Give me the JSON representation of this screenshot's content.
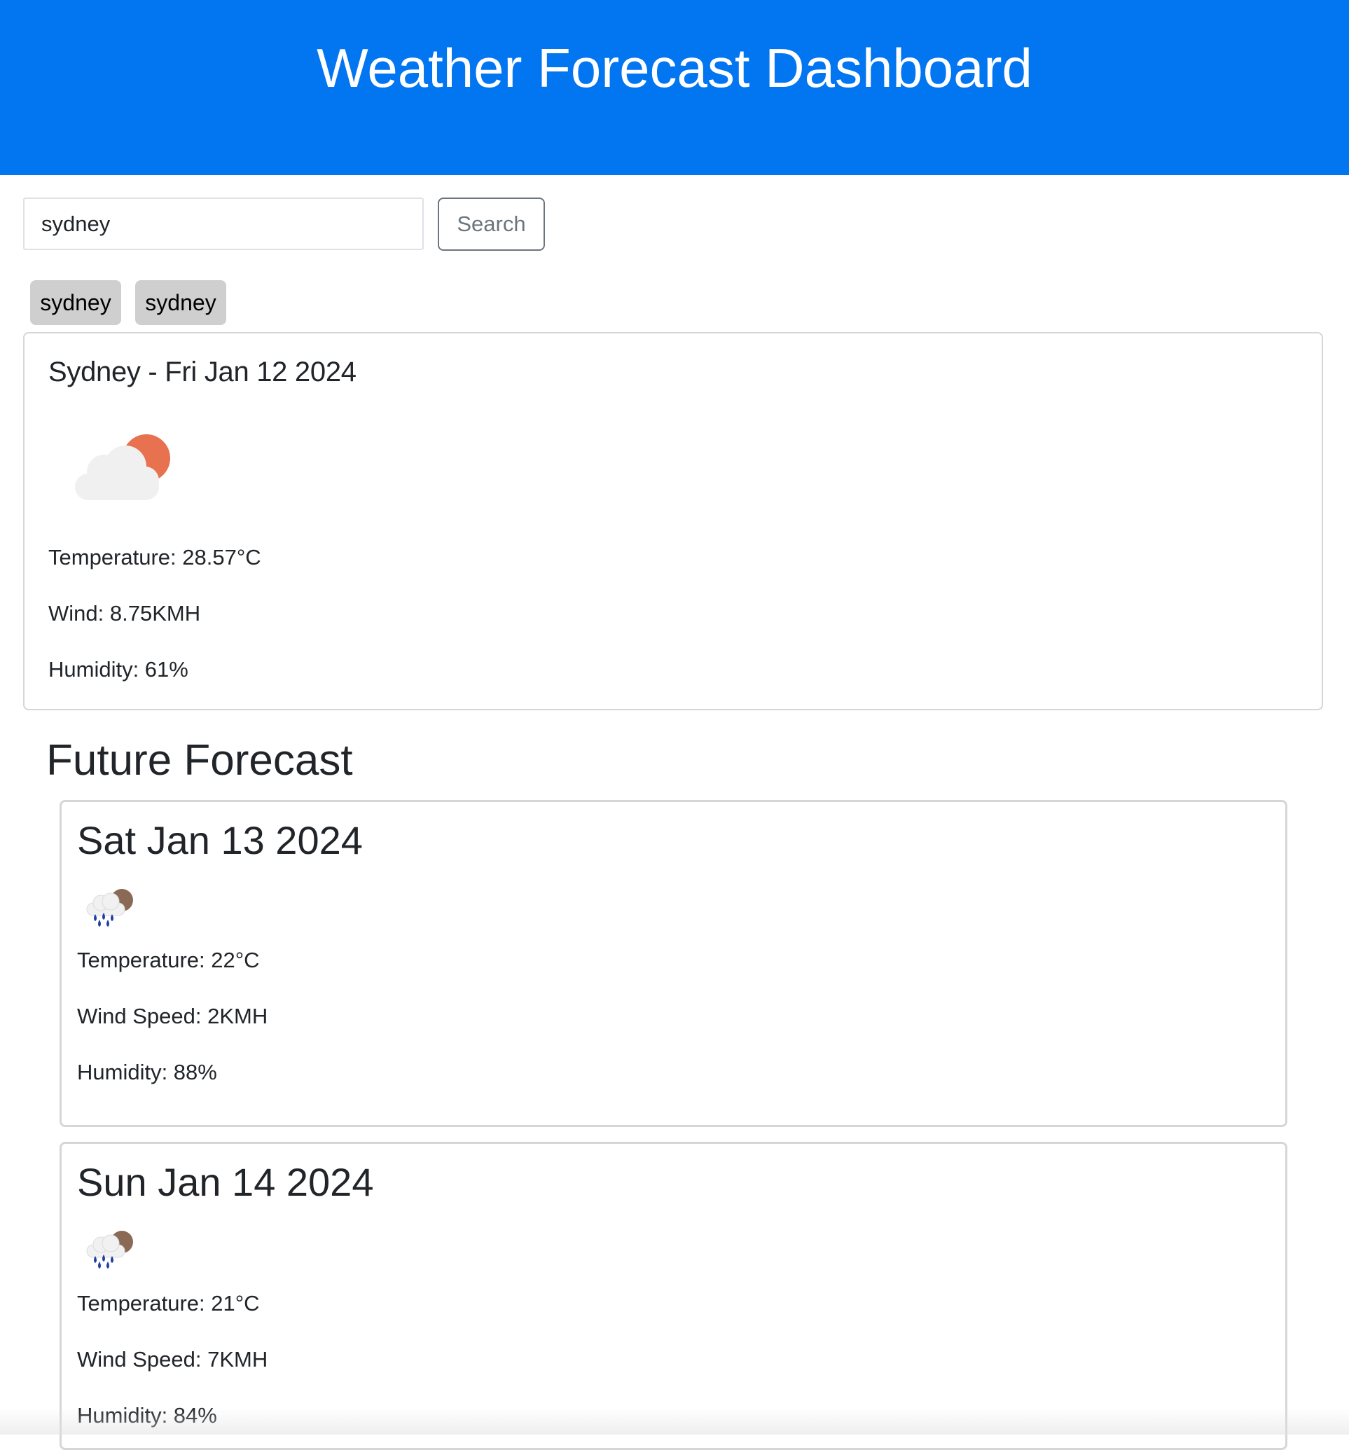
{
  "header": {
    "title": "Weather Forecast Dashboard",
    "background_color": "#0275f0"
  },
  "search": {
    "value": "sydney",
    "button_label": "Search"
  },
  "history": {
    "items": [
      "sydney",
      "sydney"
    ]
  },
  "current": {
    "title": "Sydney - Fri Jan 12 2024",
    "icon": "partly-cloudy-day-icon",
    "temperature": "Temperature: 28.57°C",
    "wind": "Wind: 8.75KMH",
    "humidity": "Humidity: 61%"
  },
  "future": {
    "heading": "Future Forecast",
    "days": [
      {
        "date": "Sat Jan 13 2024",
        "icon": "rain-icon",
        "temperature": "Temperature: 22°C",
        "wind": "Wind Speed: 2KMH",
        "humidity": "Humidity: 88%"
      },
      {
        "date": "Sun Jan 14 2024",
        "icon": "rain-icon",
        "temperature": "Temperature: 21°C",
        "wind": "Wind Speed: 7KMH",
        "humidity": "Humidity: 84%"
      }
    ]
  }
}
